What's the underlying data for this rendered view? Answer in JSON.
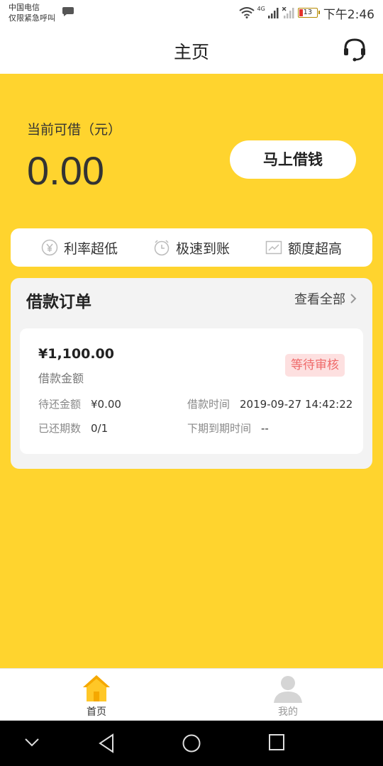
{
  "status_bar": {
    "carrier_line1": "中国电信",
    "carrier_line2": "仅限紧急呼叫",
    "network": "4G",
    "battery": "13",
    "time": "下午2:46"
  },
  "nav": {
    "title": "主页",
    "service_icon": "headset-icon"
  },
  "hero": {
    "label": "当前可借（元）",
    "amount": "0.00",
    "borrow_button": "马上借钱"
  },
  "features": [
    {
      "icon": "yen-icon",
      "label": "利率超低"
    },
    {
      "icon": "clock-icon",
      "label": "极速到账"
    },
    {
      "icon": "chart-icon",
      "label": "额度超高"
    }
  ],
  "orders": {
    "title": "借款订单",
    "view_all": "查看全部",
    "card": {
      "amount": "¥1,100.00",
      "amount_label": "借款金额",
      "status": "等待审核",
      "pending_label": "待还金额",
      "pending_value": "¥0.00",
      "time_label": "借款时间",
      "time_value": "2019-09-27 14:42:22",
      "periods_label": "已还期数",
      "periods_value": "0/1",
      "next_due_label": "下期到期时间",
      "next_due_value": "--"
    }
  },
  "tabbar": {
    "home": "首页",
    "mine": "我的"
  },
  "colors": {
    "brand_yellow": "#ffd42e",
    "status_red": "#ef6a6a",
    "status_bg": "#fde0e0"
  }
}
